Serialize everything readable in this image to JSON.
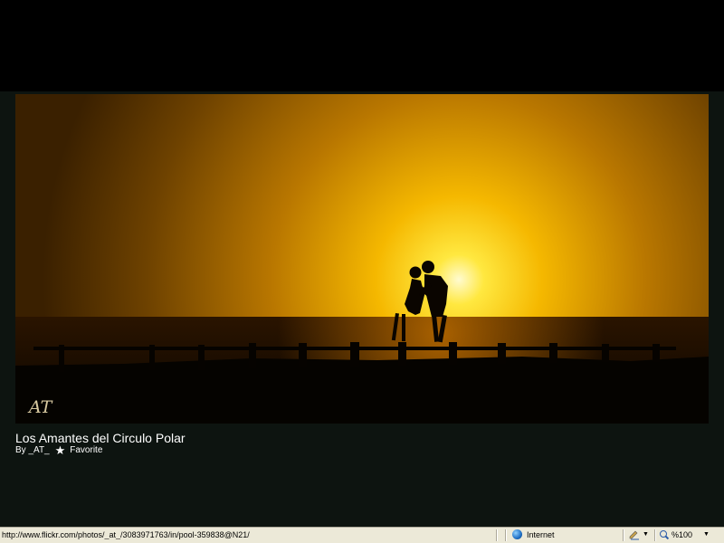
{
  "photo": {
    "title": "Los Amantes del Circulo Polar",
    "by_label": "By _AT_",
    "favorite_label": "Favorite",
    "watermark": "AT"
  },
  "statusbar": {
    "url": "http://www.flickr.com/photos/_at_/3083971763/in/pool-359838@N21/",
    "zone": "Internet",
    "zoom": "%100"
  },
  "colors": {
    "lightbox_bg": "#0d1410",
    "sky_bright": "#ffd400",
    "sky_dark": "#3a1e00"
  }
}
